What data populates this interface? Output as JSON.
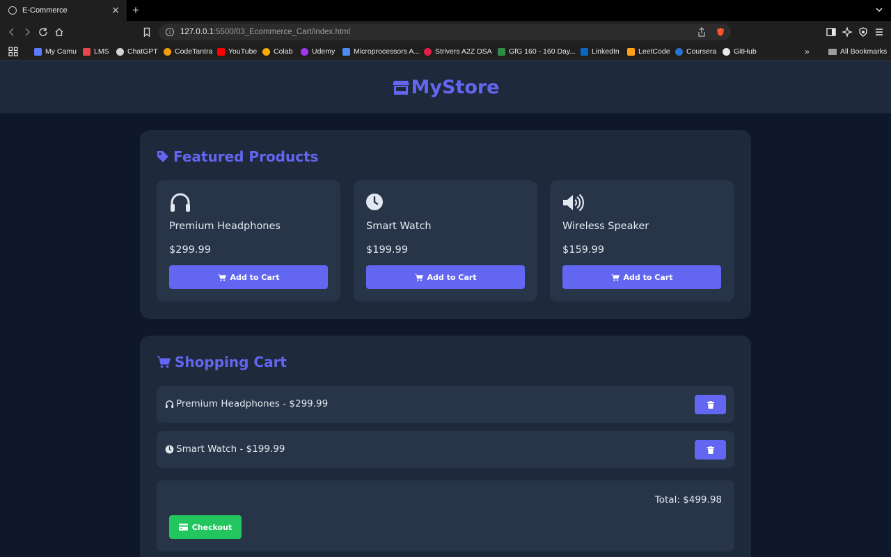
{
  "browser": {
    "tab_title": "E-Commerce",
    "tab_close": "×",
    "new_tab": "+",
    "url_host": "127.0.0.1",
    "url_path": ":5500/03_Ecommerce_Cart/index.html",
    "bookmarks": [
      {
        "label": "My Camu",
        "icon_color": "#5b7cfa"
      },
      {
        "label": "LMS",
        "icon_color": "#e5484d"
      },
      {
        "label": "ChatGPT",
        "icon_color": "#d4d4d4"
      },
      {
        "label": "CodeTantra",
        "icon_color": "#f59e0b"
      },
      {
        "label": "YouTube",
        "icon_color": "#ff0000"
      },
      {
        "label": "Colab",
        "icon_color": "#f9ab00"
      },
      {
        "label": "Udemy",
        "icon_color": "#a435f0"
      },
      {
        "label": "Microprocessors A...",
        "icon_color": "#4c8bf5"
      },
      {
        "label": "Strivers A2Z DSA",
        "icon_color": "#e11d48"
      },
      {
        "label": "GfG 160 - 160 Day...",
        "icon_color": "#2f8d46"
      },
      {
        "label": "LinkedIn",
        "icon_color": "#0a66c2"
      },
      {
        "label": "LeetCode",
        "icon_color": "#ffa116"
      },
      {
        "label": "Coursera",
        "icon_color": "#2a73cc"
      },
      {
        "label": "GitHub",
        "icon_color": "#e8e8e8"
      }
    ],
    "more_bookmarks": "»",
    "all_bookmarks": "All Bookmarks"
  },
  "store": {
    "name": "MyStore",
    "accent": "#6366f1",
    "success": "#22c55e"
  },
  "featured": {
    "title": "Featured Products",
    "products": [
      {
        "name": "Premium Headphones",
        "price": "$299.99",
        "icon": "headphones-icon",
        "button": "Add to Cart"
      },
      {
        "name": "Smart Watch",
        "price": "$199.99",
        "icon": "clock-icon",
        "button": "Add to Cart"
      },
      {
        "name": "Wireless Speaker",
        "price": "$159.99",
        "icon": "speaker-icon",
        "button": "Add to Cart"
      }
    ]
  },
  "cart": {
    "title": "Shopping Cart",
    "items": [
      {
        "text": "Premium Headphones - $299.99",
        "icon": "headphones-icon"
      },
      {
        "text": "Smart Watch - $199.99",
        "icon": "clock-icon"
      }
    ],
    "total": "Total: $499.98",
    "checkout": "Checkout"
  }
}
